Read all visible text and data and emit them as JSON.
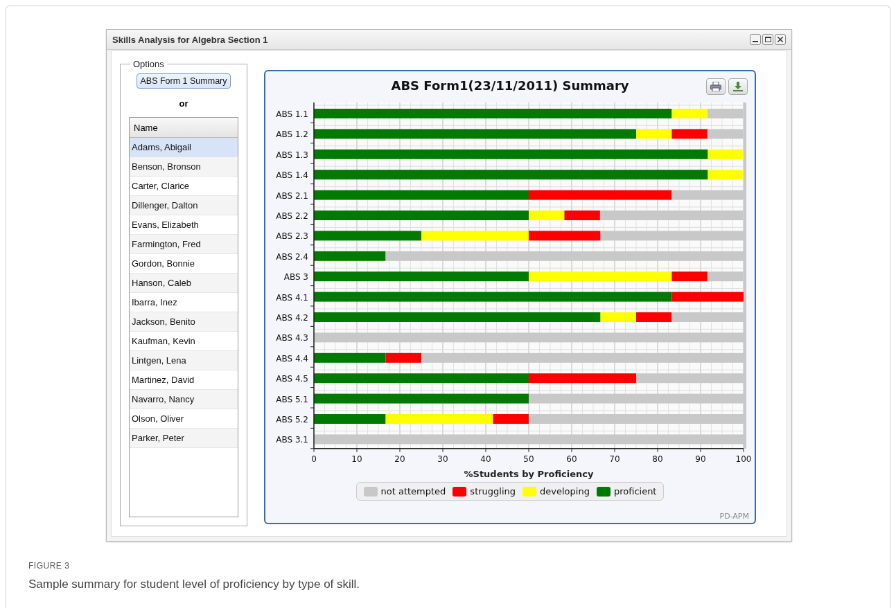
{
  "window": {
    "title": "Skills Analysis for Algebra Section 1"
  },
  "options": {
    "legend": "Options",
    "summary_button": "ABS Form 1 Summary",
    "separator": "or"
  },
  "students": {
    "column": "Name",
    "rows": [
      {
        "name": "Adams, Abigail",
        "selected": true
      },
      {
        "name": "Benson, Bronson",
        "selected": false
      },
      {
        "name": "Carter, Clarice",
        "selected": false
      },
      {
        "name": "Dillenger, Dalton",
        "selected": false
      },
      {
        "name": "Evans, Elizabeth",
        "selected": false
      },
      {
        "name": "Farmington, Fred",
        "selected": false
      },
      {
        "name": "Gordon, Bonnie",
        "selected": false
      },
      {
        "name": "Hanson, Caleb",
        "selected": false
      },
      {
        "name": "Ibarra, Inez",
        "selected": false
      },
      {
        "name": "Jackson, Benito",
        "selected": false
      },
      {
        "name": "Kaufman, Kevin",
        "selected": false
      },
      {
        "name": "Lintgen, Lena",
        "selected": false
      },
      {
        "name": "Martinez, David",
        "selected": false
      },
      {
        "name": "Navarro, Nancy",
        "selected": false
      },
      {
        "name": "Olson, Oliver",
        "selected": false
      },
      {
        "name": "Parker, Peter",
        "selected": false
      }
    ]
  },
  "chart": {
    "footer": "PD-APM",
    "chart_data": {
      "type": "bar",
      "orientation": "horizontal",
      "stacked": true,
      "grid": true,
      "legend": "bottom",
      "title": "ABS Form1(23/11/2011) Summary",
      "xlabel": "%Students by Proficiency",
      "categories": [
        "ABS 1.1",
        "ABS 1.2",
        "ABS 1.3",
        "ABS 1.4",
        "ABS 2.1",
        "ABS 2.2",
        "ABS 2.3",
        "ABS 2.4",
        "ABS 3",
        "ABS 4.1",
        "ABS 4.2",
        "ABS 4.3",
        "ABS 4.4",
        "ABS 4.5",
        "ABS 5.1",
        "ABS 5.2",
        "ABS 3.1"
      ],
      "xlim": [
        0,
        100
      ],
      "xticks": [
        0,
        10,
        20,
        30,
        40,
        50,
        60,
        70,
        80,
        90,
        100
      ],
      "series": [
        {
          "name": "not attempted",
          "color": "#c8c8c8",
          "values": [
            8.3,
            8.3,
            0,
            0,
            16.7,
            33.3,
            33.3,
            83.3,
            8.3,
            0,
            16.7,
            100,
            75,
            25,
            50,
            50,
            100
          ]
        },
        {
          "name": "struggling",
          "color": "#ff0000",
          "values": [
            0,
            8.3,
            0,
            0,
            33.3,
            8.3,
            16.7,
            0,
            8.3,
            16.7,
            8.3,
            0,
            8.3,
            25,
            0,
            8.3,
            0
          ]
        },
        {
          "name": "developing",
          "color": "#ffff00",
          "values": [
            8.3,
            8.3,
            8.3,
            8.3,
            0,
            8.3,
            25,
            0,
            33.3,
            0,
            8.3,
            0,
            0,
            0,
            0,
            25,
            0
          ]
        },
        {
          "name": "proficient",
          "color": "#007a00",
          "values": [
            83.3,
            75,
            91.7,
            91.7,
            50,
            50,
            25,
            16.7,
            50,
            83.3,
            66.7,
            0,
            16.7,
            50,
            50,
            16.7,
            0
          ]
        }
      ]
    }
  },
  "figure": {
    "label": "FIGURE 3",
    "caption": "Sample summary for student level of proficiency by type of skill."
  }
}
